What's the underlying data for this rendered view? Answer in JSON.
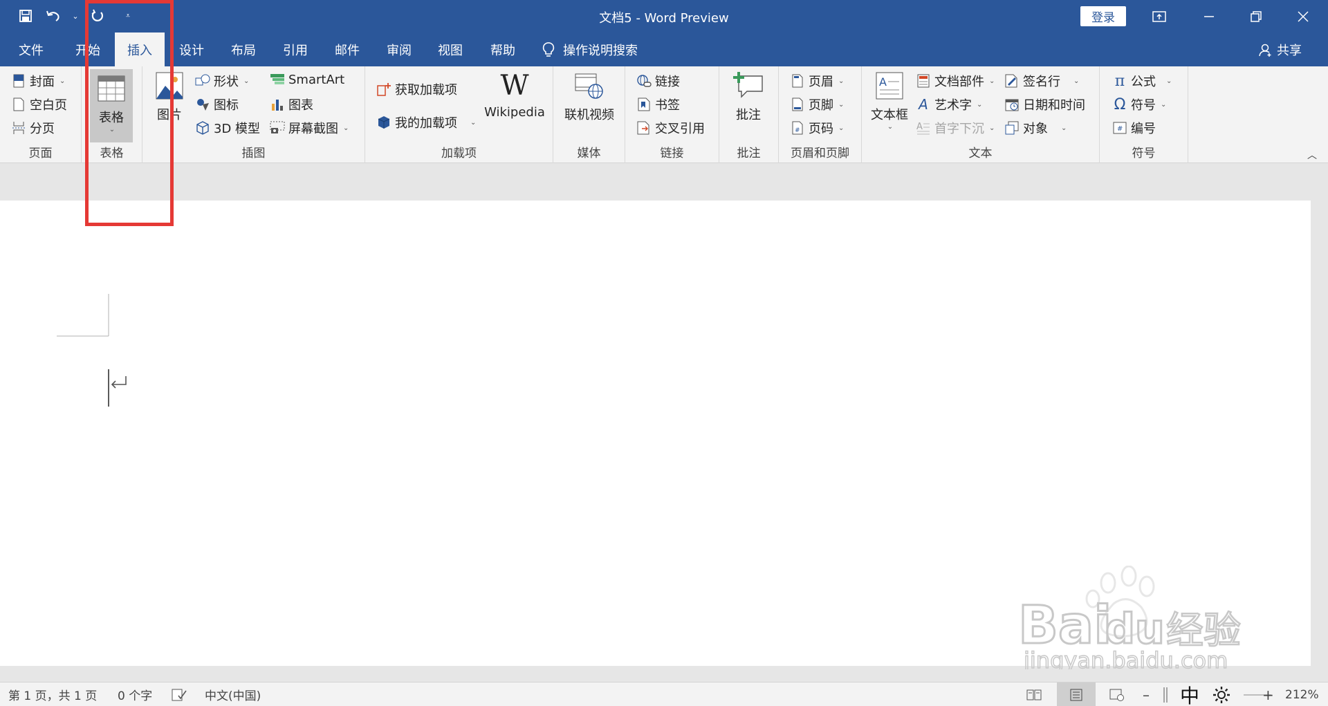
{
  "app": {
    "title": "文档5  -  Word Preview",
    "login_label": "登录"
  },
  "tabs": [
    {
      "label": "文件"
    },
    {
      "label": "开始"
    },
    {
      "label": "插入"
    },
    {
      "label": "设计"
    },
    {
      "label": "布局"
    },
    {
      "label": "引用"
    },
    {
      "label": "邮件"
    },
    {
      "label": "审阅"
    },
    {
      "label": "视图"
    },
    {
      "label": "帮助"
    }
  ],
  "tell_me": "操作说明搜索",
  "share": "共享",
  "ribbon": {
    "pages": {
      "label": "页面",
      "cover": "封面",
      "blank": "空白页",
      "break": "分页"
    },
    "tables": {
      "label": "表格",
      "table": "表格"
    },
    "illustrations": {
      "label": "插图",
      "picture": "图片",
      "shapes": "形状",
      "icons": "图标",
      "model3d": "3D 模型",
      "smartart": "SmartArt",
      "chart": "图表",
      "screenshot": "屏幕截图"
    },
    "addins": {
      "label": "加载项",
      "get": "获取加载项",
      "my": "我的加载项",
      "wikipedia": "Wikipedia"
    },
    "media": {
      "label": "媒体",
      "video": "联机视频"
    },
    "links": {
      "label": "链接",
      "link": "链接",
      "bookmark": "书签",
      "cross_ref": "交叉引用"
    },
    "comments": {
      "label": "批注",
      "comment": "批注"
    },
    "header_footer": {
      "label": "页眉和页脚",
      "header": "页眉",
      "footer": "页脚",
      "page_number": "页码"
    },
    "text": {
      "label": "文本",
      "textbox": "文本框",
      "quick_parts": "文档部件",
      "wordart": "艺术字",
      "dropcap": "首字下沉",
      "signature": "签名行",
      "datetime": "日期和时间",
      "object": "对象"
    },
    "symbols": {
      "label": "符号",
      "equation": "公式",
      "symbol": "符号",
      "number": "编号"
    }
  },
  "status": {
    "page": "第 1 页，共 1 页",
    "words": "0 个字",
    "language": "中文(中国)",
    "ime": "中",
    "zoom": "212%"
  },
  "watermark": {
    "brand": "Bai",
    "du": "du",
    "cn": "经验",
    "url": "jingyan.baidu.com"
  },
  "colors": {
    "accent": "#2b579a",
    "highlight": "#e53935"
  }
}
